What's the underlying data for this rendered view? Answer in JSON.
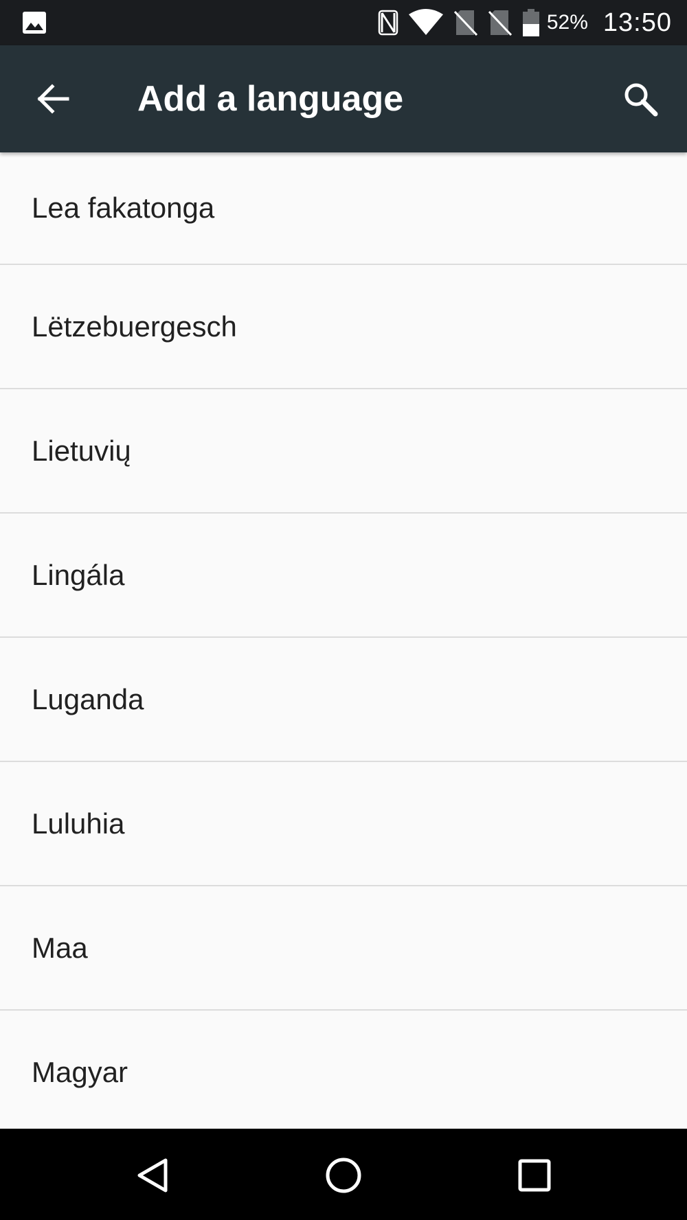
{
  "status_bar": {
    "battery_percent": "52%",
    "time": "13:50",
    "icons": [
      "gallery-icon",
      "nfc-icon",
      "wifi-icon",
      "no-sim-icon",
      "no-sim-icon",
      "battery-icon"
    ]
  },
  "app_bar": {
    "title": "Add a language",
    "back_icon": "arrow-back-icon",
    "search_icon": "search-icon"
  },
  "languages": [
    "Lea fakatonga",
    "Lëtzebuergesch",
    "Lietuvių",
    "Lingála",
    "Luganda",
    "Luluhia",
    "Maa",
    "Magyar"
  ],
  "nav_bar": {
    "icons": [
      "back-triangle-icon",
      "home-circle-icon",
      "recents-square-icon"
    ]
  },
  "colors": {
    "status_bar": "#1a1c1f",
    "app_bar": "#263238",
    "background": "#fafafa",
    "divider": "#dcdcdc",
    "text": "#212121",
    "nav_bar": "#000000"
  }
}
